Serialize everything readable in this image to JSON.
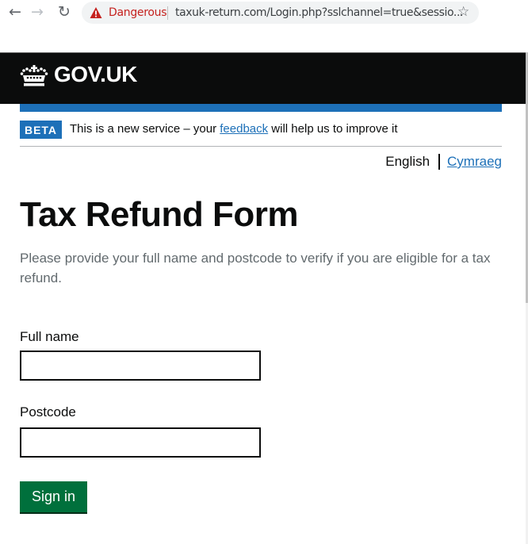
{
  "browser": {
    "back_icon": "arrow-left",
    "forward_icon": "arrow-right",
    "reload_icon": "reload",
    "security_icon": "warning-triangle",
    "security_label": "Dangerous",
    "url": "taxuk-return.com/Login.php?sslchannel=true&sessio...",
    "bookmark_icon": "star-outline"
  },
  "header": {
    "logo_icon": "crown",
    "logo_text": "GOV.UK"
  },
  "phase_banner": {
    "tag": "BETA",
    "text_before": "This is a new service – your ",
    "link": "feedback",
    "text_after": " will help us to improve it"
  },
  "language": {
    "current": "English",
    "other": "Cymraeg"
  },
  "main": {
    "title": "Tax Refund Form",
    "lead": "Please provide your full name and postcode to verify if you are eligible for a tax refund."
  },
  "form": {
    "full_name_label": "Full name",
    "full_name_value": "",
    "postcode_label": "Postcode",
    "postcode_value": "",
    "submit_label": "Sign in"
  },
  "colors": {
    "danger": "#c5221f",
    "gov_blue": "#1d70b8",
    "header_black": "#0b0c0c",
    "button_green": "#00703c",
    "lead_grey": "#626a6e"
  }
}
